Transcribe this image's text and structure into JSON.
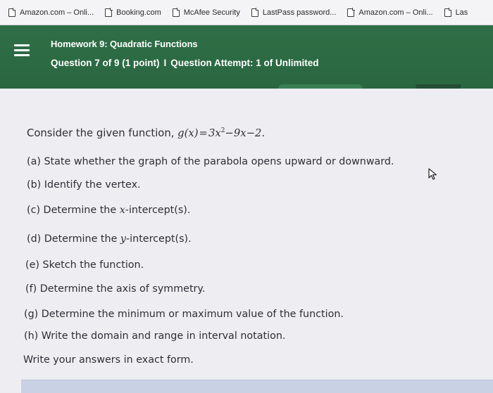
{
  "bookmarks": [
    {
      "label": "Amazon.com – Onli..."
    },
    {
      "label": "Booking.com"
    },
    {
      "label": "McAfee Security"
    },
    {
      "label": "LastPass password..."
    },
    {
      "label": "Amazon.com – Onli..."
    },
    {
      "label": "Las"
    }
  ],
  "header": {
    "title": "Homework 9: Quadratic Functions",
    "question_progress": "Question 7 of 9 (1 point)",
    "separator": "I",
    "attempt": "Question Attempt: 1 of Unlimited",
    "background_color": "#2f6e46"
  },
  "question": {
    "intro": "Consider the given function,",
    "function_lhs": "g(x)",
    "function_rhs_coef": "3x",
    "function_rhs_exp": "2",
    "function_rhs_rest": "−9x−2",
    "function_end": ".",
    "parts": [
      {
        "pre": "(a) State whether the graph of the parabola opens upward or downward.",
        "var": "",
        "post": ""
      },
      {
        "pre": "(b) Identify the vertex.",
        "var": "",
        "post": ""
      },
      {
        "pre": "(c) Determine the ",
        "var": "x",
        "post": "-intercept(s)."
      },
      {
        "pre": "(d) Determine the ",
        "var": "y",
        "post": "-intercept(s)."
      },
      {
        "pre": "(e) Sketch the function.",
        "var": "",
        "post": ""
      },
      {
        "pre": "(f) Determine the axis of symmetry.",
        "var": "",
        "post": ""
      },
      {
        "pre": "(g) Determine the minimum or maximum value of the function.",
        "var": "",
        "post": ""
      },
      {
        "pre": "(h) Write the domain and range in interval notation.",
        "var": "",
        "post": ""
      }
    ],
    "footer": "Write your answers in exact form."
  },
  "icons": {
    "bookmark": "document-icon",
    "menu": "hamburger-menu-icon",
    "pointer": "mouse-cursor-icon"
  }
}
